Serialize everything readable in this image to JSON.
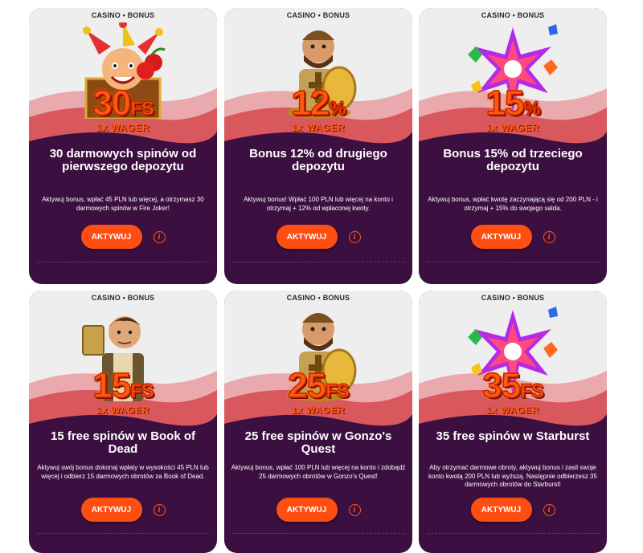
{
  "cards": [
    {
      "category": "CASINO • BONUS",
      "value": "30",
      "suffix": "FS",
      "wager": "1x WAGER",
      "title": "30 darmowych spinów od pierwszego depozytu",
      "description": "Aktywuj bonus, wpłać 45 PLN lub więcej, a otrzymasz 30 darmowych spinów w Fire Joker!",
      "button": "AKTYWUJ",
      "info": "i",
      "art": "joker-icon"
    },
    {
      "category": "CASINO • BONUS",
      "value": "12",
      "suffix": "%",
      "wager": "1x WAGER",
      "title": "Bonus 12% od drugiego depozytu",
      "description": "Aktywuj bonus! Wpłać 100 PLN lub więcej na konto i otrzymaj + 12% od wpłaconej kwoty.",
      "button": "AKTYWUJ",
      "info": "i",
      "art": "explorer-gonzo-icon"
    },
    {
      "category": "CASINO • BONUS",
      "value": "15",
      "suffix": "%",
      "wager": "1x WAGER",
      "title": "Bonus 15% od trzeciego depozytu",
      "description": "Aktywuj bonus, wpłać kwotę zaczynającą się od 200 PLN - i otrzymaj + 15% do swojego salda.",
      "button": "AKTYWUJ",
      "info": "i",
      "art": "starburst-gems-icon"
    },
    {
      "category": "CASINO • BONUS",
      "value": "15",
      "suffix": "FS",
      "wager": "1x WAGER",
      "title": "15 free spinów w Book of Dead",
      "description": "Aktywuj swój bonus dokonaj wpłaty w wysokości 45 PLN lub więcej i odbierz 15 darmowych obrotów za Book of Dead.",
      "button": "AKTYWUJ",
      "info": "i",
      "art": "adventurer-icon"
    },
    {
      "category": "CASINO • BONUS",
      "value": "25",
      "suffix": "FS",
      "wager": "1x WAGER",
      "title": "25 free spinów w Gonzo's Quest",
      "description": "Aktywuj bonus, wpłać 100 PLN lub więcej na konto i zdobądź 25 darmowych obrotów w Gonzo's Quest!",
      "button": "AKTYWUJ",
      "info": "i",
      "art": "explorer-gonzo-icon"
    },
    {
      "category": "CASINO • BONUS",
      "value": "35",
      "suffix": "FS",
      "wager": "1x WAGER",
      "title": "35 free spinów w Starburst",
      "description": "Aby otrzymać darmowe obroty, aktywuj bonus i zasil swoje konto kwotą 200 PLN lub wyższą. Następnie odbierzesz 35 darmowych obrotów do Starburst!",
      "button": "AKTYWUJ",
      "info": "i",
      "art": "starburst-gems-icon"
    }
  ],
  "colors": {
    "card_bg": "#3b1040",
    "accent": "#ff4e12",
    "top_bg": "#eeeeee",
    "wave_pink": "#e9a9ad",
    "wave_red": "#d9585e"
  }
}
